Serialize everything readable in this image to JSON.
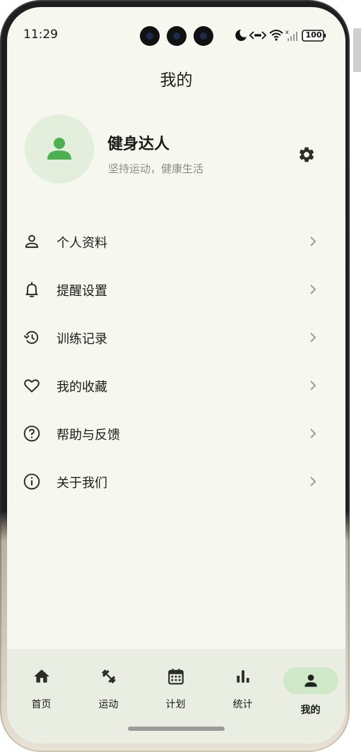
{
  "status_bar": {
    "time": "11:29",
    "battery": "100"
  },
  "header": {
    "title": "我的"
  },
  "profile": {
    "name": "健身达人",
    "motto": "坚持运动，健康生活"
  },
  "menu": [
    {
      "label": "个人资料",
      "icon": "person-outline-icon"
    },
    {
      "label": "提醒设置",
      "icon": "bell-icon"
    },
    {
      "label": "训练记录",
      "icon": "history-icon"
    },
    {
      "label": "我的收藏",
      "icon": "heart-outline-icon"
    },
    {
      "label": "帮助与反馈",
      "icon": "help-circle-icon"
    },
    {
      "label": "关于我们",
      "icon": "info-circle-icon"
    }
  ],
  "bottom_nav": {
    "items": [
      {
        "label": "首页",
        "icon": "home-icon",
        "active": false
      },
      {
        "label": "运动",
        "icon": "dumbbell-icon",
        "active": false
      },
      {
        "label": "计划",
        "icon": "calendar-icon",
        "active": false
      },
      {
        "label": "统计",
        "icon": "bar-chart-icon",
        "active": false
      },
      {
        "label": "我的",
        "icon": "person-icon",
        "active": true
      }
    ]
  },
  "colors": {
    "background": "#f6f8f0",
    "accent": "#4caf50",
    "avatar_bg": "#e3efdc",
    "nav_active_bg": "#cfe8c8",
    "nav_bg": "#e9ede2"
  }
}
